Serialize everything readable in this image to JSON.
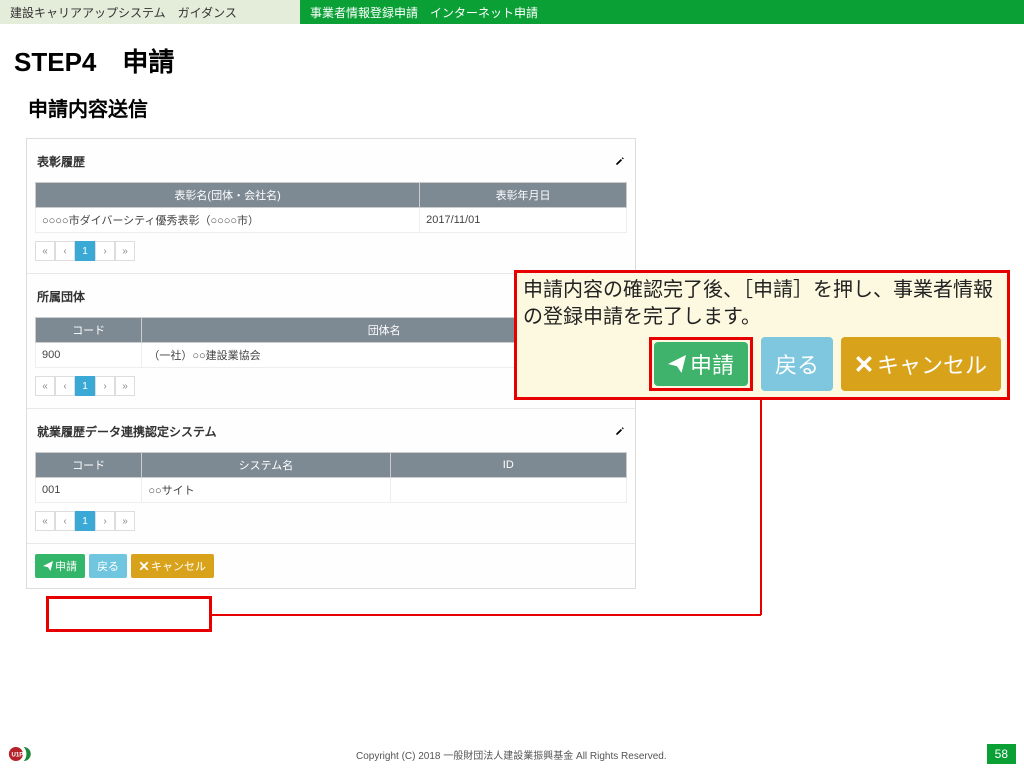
{
  "header": {
    "left": "建設キャリアアップシステム　ガイダンス",
    "right": "事業者情報登録申請　インターネット申請"
  },
  "step_title": "STEP4　申請",
  "sub_title": "申請内容送信",
  "sections": {
    "awards": {
      "title": "表彰履歴",
      "cols": [
        "表彰名(団体・会社名)",
        "表彰年月日"
      ],
      "rows": [
        [
          "○○○○市ダイバーシティ優秀表彰（○○○○市）",
          "2017/11/01"
        ]
      ]
    },
    "orgs": {
      "title": "所属団体",
      "cols": [
        "コード",
        "団体名"
      ],
      "rows": [
        [
          "900",
          "（一社）○○建設業協会"
        ]
      ]
    },
    "systems": {
      "title": "就業履歴データ連携認定システム",
      "cols": [
        "コード",
        "システム名",
        "ID"
      ],
      "rows": [
        [
          "001",
          "○○サイト",
          ""
        ]
      ]
    }
  },
  "pager": {
    "first": "«",
    "prev": "‹",
    "page": "1",
    "next": "›",
    "last": "»"
  },
  "buttons": {
    "apply": "申請",
    "back": "戻る",
    "cancel": "キャンセル"
  },
  "callout": {
    "text": "申請内容の確認完了後、［申請］を押し、事業者情報の登録申請を完了します。"
  },
  "footer": {
    "copy": "Copyright (C) 2018 一般財団法人建設業振興基金 All Rights Reserved.",
    "page": "58"
  }
}
